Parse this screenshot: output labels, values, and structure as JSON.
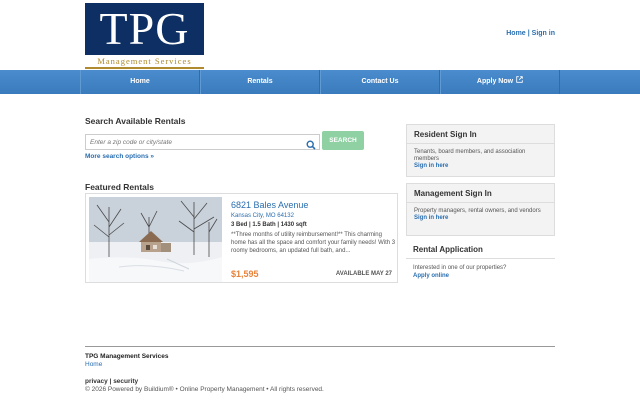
{
  "logo": {
    "main": "TPG",
    "sub": "Management Services"
  },
  "header": {
    "home_link": "Home",
    "separator": "|",
    "signin_link": "Sign in"
  },
  "nav": {
    "items": [
      {
        "label": "Home"
      },
      {
        "label": "Rentals"
      },
      {
        "label": "Contact Us"
      },
      {
        "label": "Apply Now",
        "icon": "external-link-icon"
      }
    ]
  },
  "search": {
    "heading": "Search Available Rentals",
    "placeholder": "Enter a zip code or city/state",
    "button_label": "SEARCH",
    "more_options": "More search options »"
  },
  "featured": {
    "heading": "Featured Rentals",
    "listing": {
      "title": "6821 Bales Avenue",
      "city": "Kansas City, MO 64132",
      "specs": "3 Bed | 1.5 Bath | 1430 sqft",
      "description": "**Three months of utility reimbursement!** This charming home has all the space and comfort your family needs! With 3 roomy bedrooms, an updated full bath, and...",
      "price": "$1,595",
      "availability": "AVAILABLE MAY 27"
    }
  },
  "sidebar": {
    "resident": {
      "title": "Resident Sign In",
      "text": "Tenants, board members, and association members",
      "link": "Sign in here"
    },
    "management": {
      "title": "Management Sign In",
      "text": "Property managers, rental owners, and vendors",
      "link": "Sign in here"
    },
    "application": {
      "title": "Rental Application",
      "text": "Interested in one of our properties?",
      "link": "Apply online"
    }
  },
  "footer": {
    "company": "TPG Management Services",
    "home": "Home",
    "links": "privacy | security",
    "copyright": "© 2026 Powered by Buildium® • Online Property Management • All rights reserved."
  },
  "colors": {
    "brand_navy": "#0d2f63",
    "nav_blue": "#3a7bbd",
    "link_blue": "#2a6eb0",
    "price_orange": "#e8823a",
    "search_green": "#8fd1a3"
  }
}
